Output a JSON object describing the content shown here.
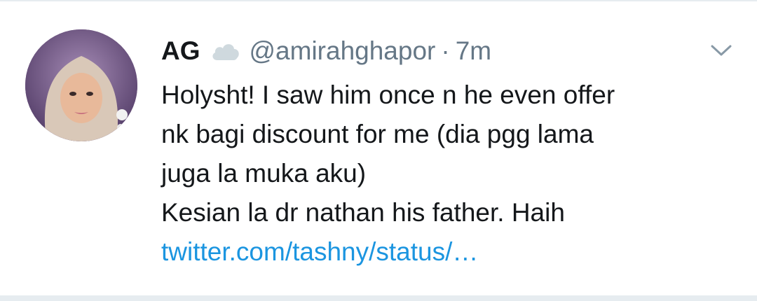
{
  "tweet": {
    "display_name": "AG",
    "handle": "@amirahghapor",
    "separator": "·",
    "time": "7m",
    "status_icon": "cloud-icon",
    "menu_icon": "chevron-down-icon",
    "avatar": "user-avatar",
    "lines": [
      "Holysht! I saw him once n he even offer",
      "nk bagi discount for me (dia pgg lama",
      "juga la muka aku)",
      "Kesian la dr nathan his father. Haih"
    ],
    "link": "twitter.com/tashny/status/…"
  },
  "colors": {
    "text": "#14171a",
    "secondary": "#657786",
    "link": "#1b95e0",
    "divider": "#e6ecf0"
  }
}
